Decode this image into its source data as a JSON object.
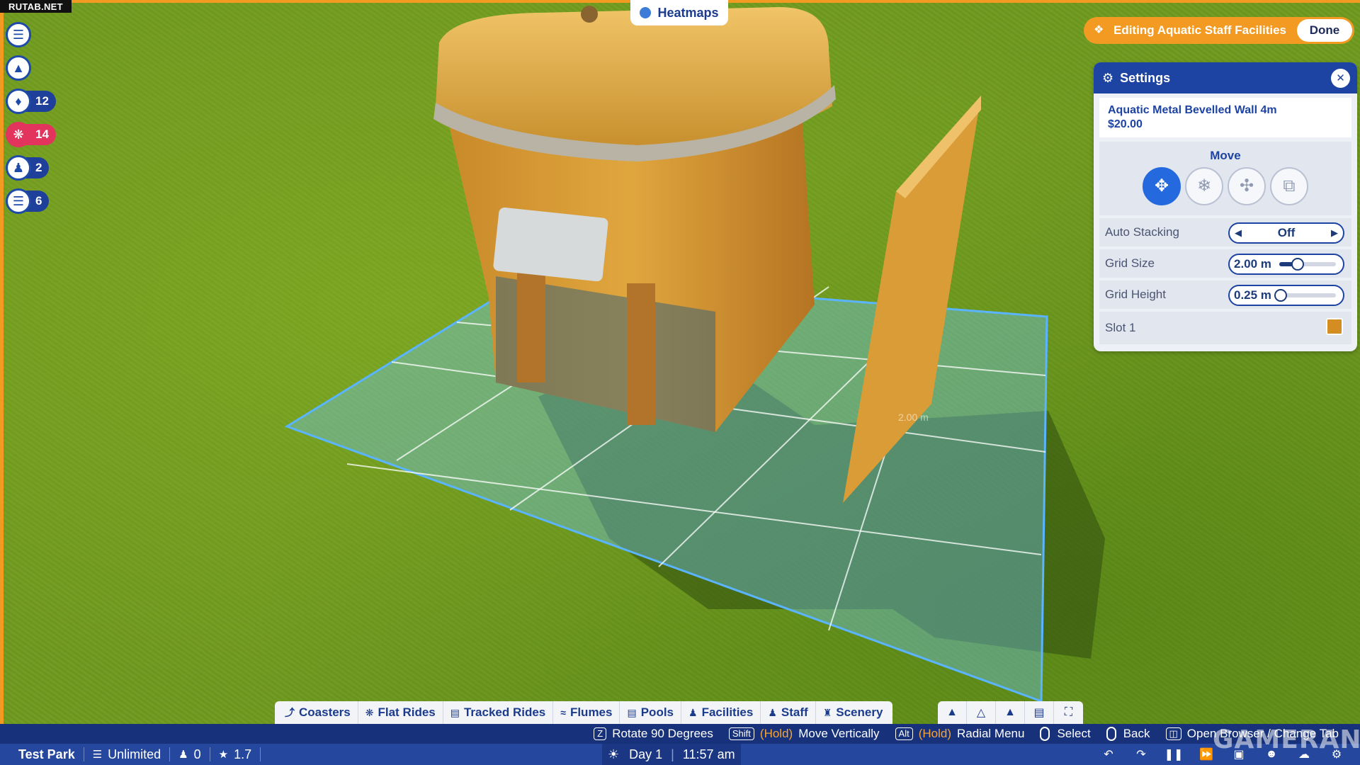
{
  "watermark": "RUTAB.NET",
  "heatmaps": {
    "label": "Heatmaps"
  },
  "editing": {
    "label": "Editing Aquatic Staff Facilities",
    "done_label": "Done"
  },
  "left_stack": [
    {
      "icon": "clipboard-icon",
      "count": ""
    },
    {
      "icon": "scenery-icon",
      "count": ""
    },
    {
      "icon": "bell-icon",
      "count": "12"
    },
    {
      "icon": "alert-wheel-icon",
      "count": "14"
    },
    {
      "icon": "staff-icon",
      "count": "2"
    },
    {
      "icon": "notes-icon",
      "count": "6"
    }
  ],
  "settings": {
    "title": "Settings",
    "item_name": "Aquatic Metal Bevelled Wall 4m",
    "item_price": "$20.00",
    "move_title": "Move",
    "auto_stacking": {
      "label": "Auto Stacking",
      "value": "Off"
    },
    "grid_size": {
      "label": "Grid Size",
      "value": "2.00 m",
      "level": 0.32
    },
    "grid_height": {
      "label": "Grid Height",
      "value": "0.25 m",
      "level": 0.03
    },
    "slot": {
      "label": "Slot 1",
      "color": "#d38d20"
    }
  },
  "scene": {
    "measure_label": "2.00 m"
  },
  "tabs": [
    {
      "label": "Coasters",
      "icon": "coaster-icon"
    },
    {
      "label": "Flat Rides",
      "icon": "flat-ride-icon"
    },
    {
      "label": "Tracked Rides",
      "icon": "tracked-ride-icon"
    },
    {
      "label": "Flumes",
      "icon": "flume-icon"
    },
    {
      "label": "Pools",
      "icon": "pool-icon"
    },
    {
      "label": "Facilities",
      "icon": "facilities-icon"
    },
    {
      "label": "Staff",
      "icon": "staff-icon"
    },
    {
      "label": "Scenery",
      "icon": "scenery-icon"
    }
  ],
  "hints": {
    "rotate_key": "Z",
    "rotate": "Rotate 90 Degrees",
    "move_key": "Shift",
    "hold": "(Hold)",
    "move": "Move Vertically",
    "radial_key": "Alt",
    "radial": "Radial Menu",
    "select": "Select",
    "back": "Back",
    "browser": "Open Browser / Change Tab"
  },
  "status": {
    "park": "Test Park",
    "money": "Unlimited",
    "guests": "0",
    "rating": "1.7",
    "day": "Day 1",
    "time": "11:57 am"
  },
  "brand_watermark": "GAMERANT",
  "colors": {
    "accent": "#f29a21",
    "primary": "#1d43a3",
    "status_bar": "#25489e"
  }
}
